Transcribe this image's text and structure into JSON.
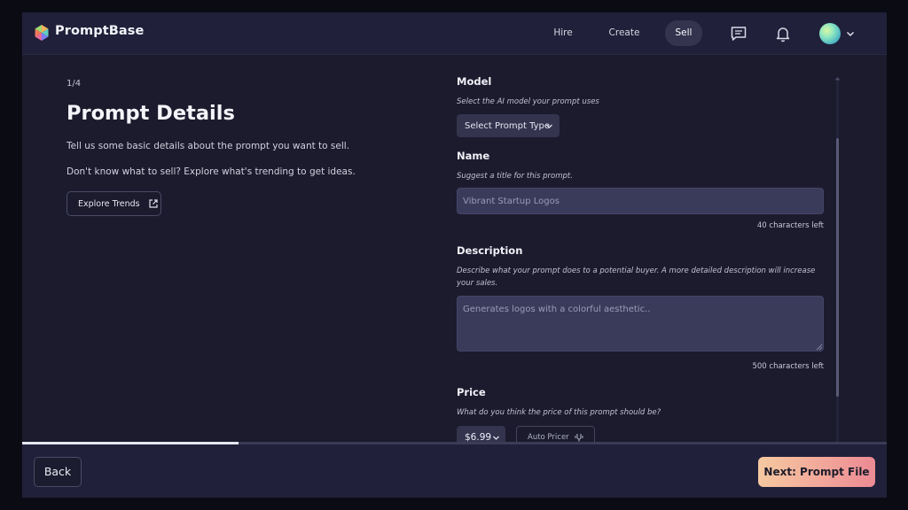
{
  "header": {
    "brand": "PromptBase",
    "nav": [
      {
        "label": "Hire"
      },
      {
        "label": "Create"
      },
      {
        "label": "Sell"
      }
    ]
  },
  "left": {
    "step": "1/4",
    "title": "Prompt Details",
    "intro1": "Tell us some basic details about the prompt you want to sell.",
    "intro2": "Don't know what to sell? Explore what's trending to get ideas.",
    "explore_label": "Explore Trends"
  },
  "form": {
    "model": {
      "label": "Model",
      "hint": "Select the AI model your prompt uses",
      "selected": "Select Prompt Type"
    },
    "name": {
      "label": "Name",
      "hint": "Suggest a title for this prompt.",
      "placeholder": "Vibrant Startup Logos",
      "counter": "40 characters left"
    },
    "description": {
      "label": "Description",
      "hint": "Describe what your prompt does to a potential buyer. A more detailed description will increase your sales.",
      "placeholder": "Generates logos with a colorful aesthetic..",
      "counter": "500 characters left"
    },
    "price": {
      "label": "Price",
      "hint": "What do you think the price of this prompt should be?",
      "selected": "$6.99",
      "auto_pricer": "Auto Pricer"
    }
  },
  "progress": {
    "fraction": 0.25
  },
  "footer": {
    "back_label": "Back",
    "next_label": "Next: Prompt File"
  },
  "icons": {
    "logo": "promptbase-logo-icon",
    "chat": "chat-icon",
    "bell": "bell-icon",
    "external": "external-link-icon",
    "chevron": "chevron-down-icon",
    "tuning": "tuning-fork-icon"
  },
  "colors": {
    "background": "#1b1b2d",
    "header": "#20203a",
    "input": "#3a3a5a",
    "next_gradient_start": "#f5c9a0",
    "next_gradient_end": "#ec8a94"
  }
}
